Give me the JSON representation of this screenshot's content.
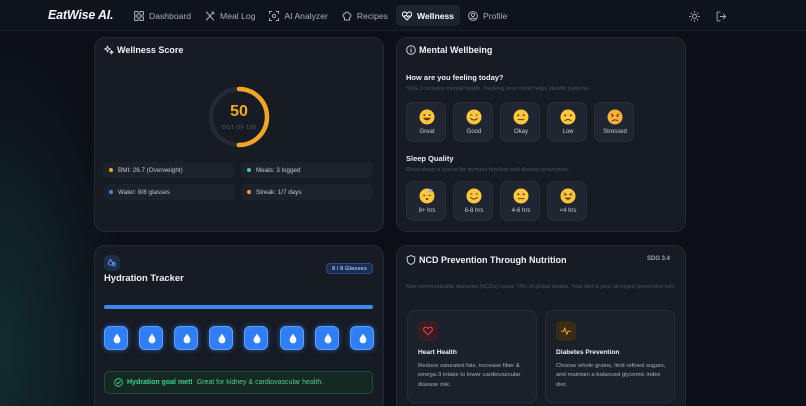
{
  "app": {
    "logo": "EatWise AI."
  },
  "nav": {
    "items": [
      {
        "label": "Dashboard",
        "icon": "grid-icon"
      },
      {
        "label": "Meal Log",
        "icon": "utensils-icon"
      },
      {
        "label": "AI Analyzer",
        "icon": "scan-icon"
      },
      {
        "label": "Recipes",
        "icon": "chef-hat-icon"
      },
      {
        "label": "Wellness",
        "icon": "heart-pulse-icon"
      },
      {
        "label": "Profile",
        "icon": "user-icon"
      }
    ],
    "active": "Wellness",
    "right_icons": [
      "sun-icon",
      "logout-icon"
    ]
  },
  "wellness_score": {
    "title": "Wellness Score",
    "score": "50",
    "score_caption": "OUT OF 100",
    "score_fraction": 0.5,
    "stats": [
      {
        "text": "BMI: 26.7 (Overweight)",
        "color": "#f5a524"
      },
      {
        "text": "Meals: 3 logged",
        "color": "#3fcf8e"
      },
      {
        "text": "Water: 8/8 glasses",
        "color": "#3f86f0"
      },
      {
        "text": "Streak: 1/7 days",
        "color": "#f5a524"
      }
    ]
  },
  "mental": {
    "title": "Mental Wellbeing",
    "question": "How are you feeling today?",
    "question_desc": "SDG 3 includes mental health. Tracking your mood helps identify patterns.",
    "moods": [
      {
        "label": "Great",
        "icon": "grinning-face-icon"
      },
      {
        "label": "Good",
        "icon": "smiling-face-icon"
      },
      {
        "label": "Okay",
        "icon": "neutral-face-icon"
      },
      {
        "label": "Low",
        "icon": "sad-face-icon"
      },
      {
        "label": "Stressed",
        "icon": "stressed-face-icon"
      }
    ],
    "sleep_title": "Sleep Quality",
    "sleep_desc": "Good sleep is crucial for immune function and disease prevention.",
    "sleep": [
      {
        "label": "8+ hrs",
        "icon": "sleeping-face-icon"
      },
      {
        "label": "6-8 hrs",
        "icon": "smiling-face-icon"
      },
      {
        "label": "4-6 hrs",
        "icon": "neutral-face-icon"
      },
      {
        "label": "<4 hrs",
        "icon": "tired-face-icon"
      }
    ]
  },
  "hydration": {
    "title": "Hydration Tracker",
    "badge": "8 / 8 Glasses",
    "progress": 1.0,
    "glasses_filled": 8,
    "glasses_total": 8,
    "goal_strong": "Hydration goal met!",
    "goal_text": " Great for kidney & cardiovascular health."
  },
  "ncd": {
    "title": "NCD Prevention Through Nutrition",
    "sdg": "SDG 3.4",
    "intro": "Non-communicable diseases (NCDs) cause 74% of global deaths. Your diet is your strongest preventive tool.",
    "cards": [
      {
        "title": "Heart Health",
        "text": "Reduce saturated fats, increase fiber & omega-3 intake to lower cardiovascular disease risk.",
        "icon": "heart-icon",
        "color": "#e5484d"
      },
      {
        "title": "Diabetes Prevention",
        "text": "Choose whole grains, limit refined sugars, and maintain a balanced glycemic index diet.",
        "icon": "activity-icon",
        "color": "#f5a524"
      }
    ]
  },
  "colors": {
    "accent": "#3f86f0",
    "score": "#f5a524",
    "success": "#3fcf8e",
    "danger": "#e5484d"
  }
}
